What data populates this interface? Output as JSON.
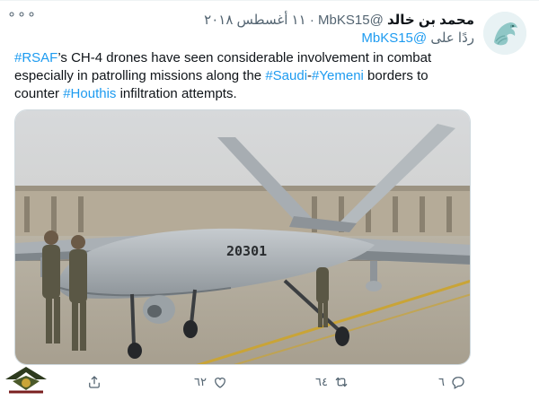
{
  "tweet": {
    "author_name": "محمد بن خالد",
    "handle": "@MbKS15",
    "separator": "·",
    "date": "١١ أغسطس ٢٠١٨",
    "reply_prefix": "ردًا على",
    "reply_handle": "@MbKS15",
    "body": [
      {
        "t": "#RSAF",
        "tag": true
      },
      {
        "t": "’s CH-4 drones have seen considerable involvement in combat especially in patrolling missions along the ",
        "tag": false
      },
      {
        "t": "#Saudi",
        "tag": true
      },
      {
        "t": "-",
        "tag": false
      },
      {
        "t": "#Yemeni",
        "tag": true
      },
      {
        "t": " borders to counter ",
        "tag": false
      },
      {
        "t": "#Houthis",
        "tag": true
      },
      {
        "t": " infiltration attempts.",
        "tag": false
      }
    ],
    "image": {
      "aircraft_number": "20301"
    },
    "actions": {
      "replies": "٦",
      "retweets": "٦٤",
      "likes": "٦٢"
    },
    "more_label": "∘∘∘"
  },
  "colors": {
    "accent": "#1d9bf0",
    "secondary_text": "#536471",
    "primary_text": "#0f1419"
  }
}
